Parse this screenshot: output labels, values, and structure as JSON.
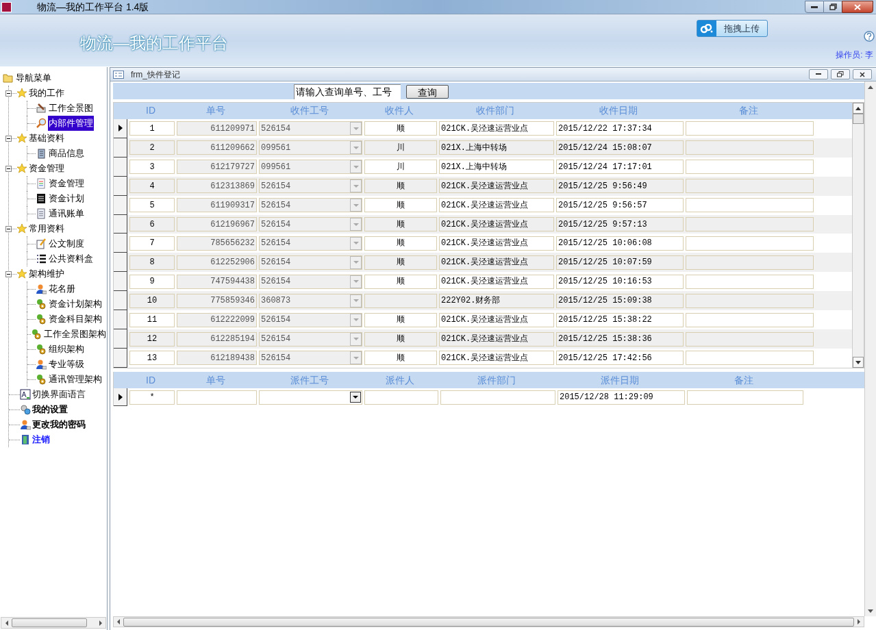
{
  "window": {
    "title": "物流—我的工作平台 1.4版"
  },
  "header": {
    "title": "物流—我的工作平台",
    "upload_button": "拖拽上传",
    "operator": "操作员: 李"
  },
  "nav": {
    "root": "导航菜单",
    "items": [
      {
        "label": "我的工作",
        "kind": "group",
        "expanded": true,
        "children": [
          {
            "label": "工作全景图",
            "selected": false
          },
          {
            "label": "内部件管理",
            "selected": true
          }
        ]
      },
      {
        "label": "基础资料",
        "kind": "group",
        "expanded": true,
        "children": [
          {
            "label": "商品信息",
            "selected": false
          }
        ]
      },
      {
        "label": "资金管理",
        "kind": "group",
        "expanded": true,
        "children": [
          {
            "label": "资金管理",
            "selected": false
          },
          {
            "label": "资金计划",
            "selected": false
          },
          {
            "label": "通讯账单",
            "selected": false
          }
        ]
      },
      {
        "label": "常用资料",
        "kind": "group",
        "expanded": true,
        "children": [
          {
            "label": "公文制度",
            "selected": false
          },
          {
            "label": "公共资料盒",
            "selected": false
          }
        ]
      },
      {
        "label": "架构维护",
        "kind": "group",
        "expanded": true,
        "children": [
          {
            "label": "花名册",
            "selected": false
          },
          {
            "label": "资金计划架构",
            "selected": false
          },
          {
            "label": "资金科目架构",
            "selected": false
          },
          {
            "label": "工作全景图架构",
            "selected": false
          },
          {
            "label": "组织架构",
            "selected": false
          },
          {
            "label": "专业等级",
            "selected": false
          },
          {
            "label": "通讯管理架构",
            "selected": false
          }
        ]
      },
      {
        "label": "切换界面语言",
        "kind": "plain"
      },
      {
        "label": "我的设置",
        "kind": "bold"
      },
      {
        "label": "更改我的密码",
        "kind": "bold"
      },
      {
        "label": "注销",
        "kind": "link"
      }
    ]
  },
  "form": {
    "title": "frm_快件登记",
    "search_value": "请输入查询单号、工号",
    "search_button": "查询",
    "received": {
      "columns": [
        "ID",
        "单号",
        "收件工号",
        "收件人",
        "收件部门",
        "收件日期",
        "备注"
      ],
      "rows": [
        {
          "id": "1",
          "number": "611209971",
          "staff_no": "526154",
          "person": "顺",
          "dept": "021CK.吴泾速运营业点",
          "date": "2015/12/22 17:37:34",
          "current": true
        },
        {
          "id": "2",
          "number": "611209662",
          "staff_no": "099561",
          "person": "川",
          "dept": "021X.上海中转场",
          "date": "2015/12/24 15:08:07",
          "current": false
        },
        {
          "id": "3",
          "number": "612179727",
          "staff_no": "099561",
          "person": "川",
          "dept": "021X.上海中转场",
          "date": "2015/12/24 17:17:01",
          "current": false
        },
        {
          "id": "4",
          "number": "612313869",
          "staff_no": "526154",
          "person": "顺",
          "dept": "021CK.吴泾速运营业点",
          "date": "2015/12/25 9:56:49",
          "current": false
        },
        {
          "id": "5",
          "number": "611909317",
          "staff_no": "526154",
          "person": "顺",
          "dept": "021CK.吴泾速运营业点",
          "date": "2015/12/25 9:56:57",
          "current": false
        },
        {
          "id": "6",
          "number": "612196967",
          "staff_no": "526154",
          "person": "顺",
          "dept": "021CK.吴泾速运营业点",
          "date": "2015/12/25 9:57:13",
          "current": false
        },
        {
          "id": "7",
          "number": "785656232",
          "staff_no": "526154",
          "person": "顺",
          "dept": "021CK.吴泾速运营业点",
          "date": "2015/12/25 10:06:08",
          "current": false
        },
        {
          "id": "8",
          "number": "612252906",
          "staff_no": "526154",
          "person": "顺",
          "dept": "021CK.吴泾速运营业点",
          "date": "2015/12/25 10:07:59",
          "current": false
        },
        {
          "id": "9",
          "number": "747594438",
          "staff_no": "526154",
          "person": "顺",
          "dept": "021CK.吴泾速运营业点",
          "date": "2015/12/25 10:16:53",
          "current": false
        },
        {
          "id": "10",
          "number": "775859346",
          "staff_no": "360873",
          "dept": "222Y02.财务部",
          "date": "2015/12/25 15:09:38",
          "current": false
        },
        {
          "id": "11",
          "number": "612222099",
          "staff_no": "526154",
          "person": "顺",
          "dept": "021CK.吴泾速运营业点",
          "date": "2015/12/25 15:38:22",
          "current": false
        },
        {
          "id": "12",
          "number": "612285194",
          "staff_no": "526154",
          "person": "顺",
          "dept": "021CK.吴泾速运营业点",
          "date": "2015/12/25 15:38:36",
          "current": false
        },
        {
          "id": "13",
          "number": "612189438",
          "staff_no": "526154",
          "person": "顺",
          "dept": "021CK.吴泾速运营业点",
          "date": "2015/12/25 17:42:56",
          "current": false
        }
      ]
    },
    "dispatched": {
      "columns": [
        "ID",
        "单号",
        "派件工号",
        "派件人",
        "派件部门",
        "派件日期",
        "备注"
      ],
      "rows": [
        {
          "id": "*",
          "date": "2015/12/28 11:29:09",
          "current": true
        }
      ]
    }
  }
}
